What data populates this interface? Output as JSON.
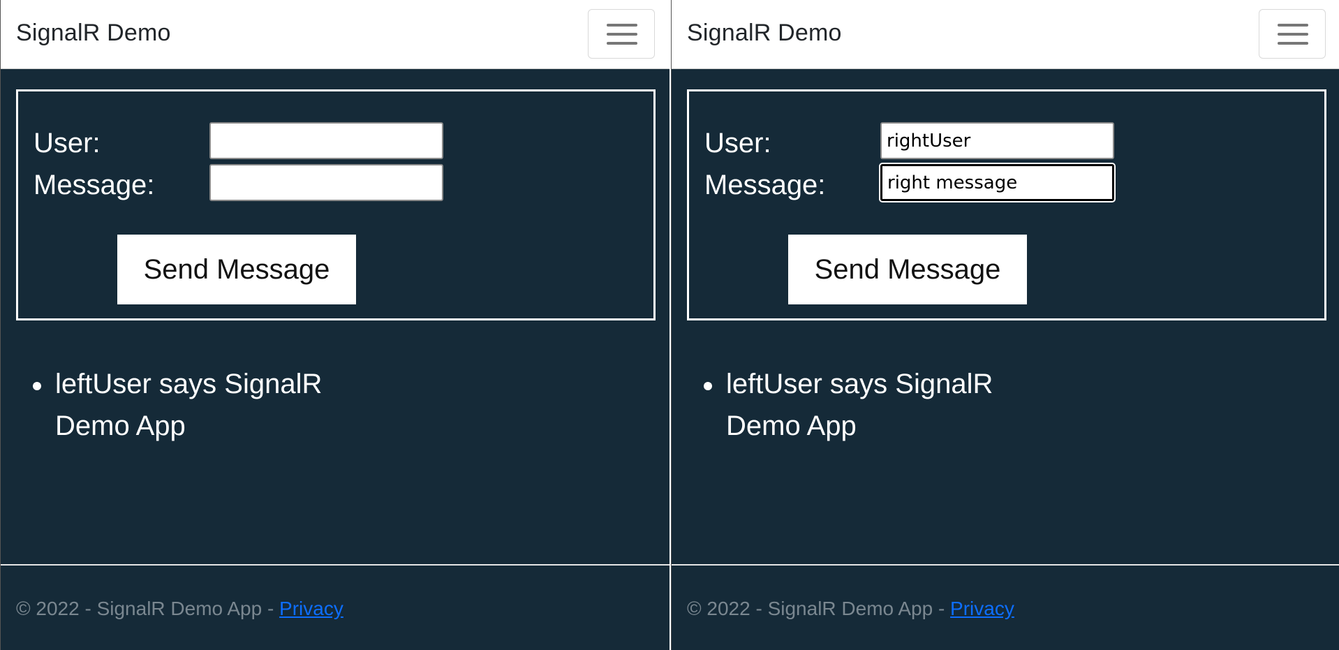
{
  "left_window": {
    "brand": "SignalR Demo",
    "form": {
      "user_label": "User:",
      "message_label": "Message:",
      "user_value": "",
      "message_value": "",
      "send_label": "Send Message"
    },
    "messages": [
      "leftUser says SignalR Demo App"
    ],
    "footer": {
      "text": "© 2022 - SignalR Demo App - ",
      "privacy_link": "Privacy"
    }
  },
  "right_window": {
    "brand": "SignalR Demo",
    "form": {
      "user_label": "User:",
      "message_label": "Message:",
      "user_value": "rightUser",
      "message_value": "right message",
      "send_label": "Send Message"
    },
    "messages": [
      "leftUser says SignalR Demo App"
    ],
    "footer": {
      "text": "© 2022 - SignalR Demo App - ",
      "privacy_link": "Privacy"
    }
  },
  "icons": {
    "toggler": "hamburger-menu-icon"
  },
  "colors": {
    "page_background": "#152a38",
    "navbar_background": "#ffffff",
    "link": "#0d6efd",
    "footer_text": "#7a8790"
  }
}
